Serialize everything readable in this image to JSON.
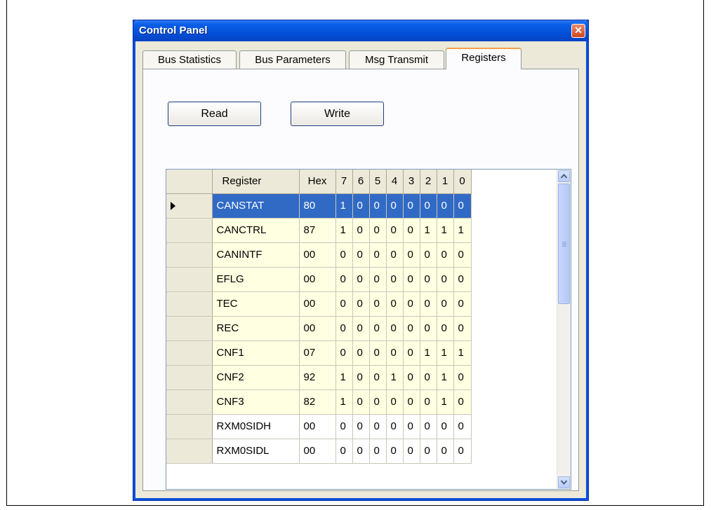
{
  "window": {
    "title": "Control Panel"
  },
  "tabs": [
    {
      "label": "Bus Statistics"
    },
    {
      "label": "Bus Parameters"
    },
    {
      "label": "Msg Transmit"
    },
    {
      "label": "Registers"
    }
  ],
  "active_tab": "Registers",
  "buttons": {
    "read": "Read",
    "write": "Write"
  },
  "grid": {
    "columns": [
      "Register",
      "Hex",
      "7",
      "6",
      "5",
      "4",
      "3",
      "2",
      "1",
      "0"
    ],
    "selected_row": 0,
    "rows": [
      {
        "register": "CANSTAT",
        "hex": "80",
        "bits": [
          "1",
          "0",
          "0",
          "0",
          "0",
          "0",
          "0",
          "0"
        ]
      },
      {
        "register": "CANCTRL",
        "hex": "87",
        "bits": [
          "1",
          "0",
          "0",
          "0",
          "0",
          "1",
          "1",
          "1"
        ]
      },
      {
        "register": "CANINTF",
        "hex": "00",
        "bits": [
          "0",
          "0",
          "0",
          "0",
          "0",
          "0",
          "0",
          "0"
        ]
      },
      {
        "register": "EFLG",
        "hex": "00",
        "bits": [
          "0",
          "0",
          "0",
          "0",
          "0",
          "0",
          "0",
          "0"
        ]
      },
      {
        "register": "TEC",
        "hex": "00",
        "bits": [
          "0",
          "0",
          "0",
          "0",
          "0",
          "0",
          "0",
          "0"
        ]
      },
      {
        "register": "REC",
        "hex": "00",
        "bits": [
          "0",
          "0",
          "0",
          "0",
          "0",
          "0",
          "0",
          "0"
        ]
      },
      {
        "register": "CNF1",
        "hex": "07",
        "bits": [
          "0",
          "0",
          "0",
          "0",
          "0",
          "1",
          "1",
          "1"
        ]
      },
      {
        "register": "CNF2",
        "hex": "92",
        "bits": [
          "1",
          "0",
          "0",
          "1",
          "0",
          "0",
          "1",
          "0"
        ]
      },
      {
        "register": "CNF3",
        "hex": "82",
        "bits": [
          "1",
          "0",
          "0",
          "0",
          "0",
          "0",
          "1",
          "0"
        ]
      },
      {
        "register": "RXM0SIDH",
        "hex": "00",
        "bits": [
          "0",
          "0",
          "0",
          "0",
          "0",
          "0",
          "0",
          "0"
        ]
      },
      {
        "register": "RXM0SIDL",
        "hex": "00",
        "bits": [
          "0",
          "0",
          "0",
          "0",
          "0",
          "0",
          "0",
          "0"
        ]
      }
    ]
  },
  "icons": {
    "close": "close-icon",
    "current_row": "row-pointer-icon",
    "scroll_up": "chevron-up-icon",
    "scroll_down": "chevron-down-icon"
  },
  "colors": {
    "titlebar": "#0450d8",
    "selection": "#316ac5",
    "cell_bg": "#ffffe1",
    "active_tab_accent": "#f5a04a"
  }
}
